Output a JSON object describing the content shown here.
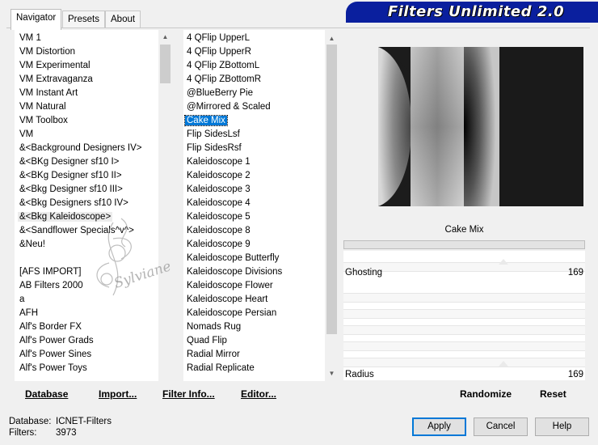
{
  "tabs": [
    "Navigator",
    "Presets",
    "About"
  ],
  "banner": "Filters Unlimited 2.0",
  "categories": [
    {
      "label": "VM 1"
    },
    {
      "label": "VM Distortion"
    },
    {
      "label": "VM Experimental"
    },
    {
      "label": "VM Extravaganza"
    },
    {
      "label": "VM Instant Art"
    },
    {
      "label": "VM Natural"
    },
    {
      "label": "VM Toolbox"
    },
    {
      "label": "VM"
    },
    {
      "label": "&<Background Designers IV>"
    },
    {
      "label": "&<BKg Designer sf10 I>"
    },
    {
      "label": "&<BKg Designer sf10 II>"
    },
    {
      "label": "&<Bkg Designer sf10 III>"
    },
    {
      "label": "&<Bkg Designers sf10 IV>"
    },
    {
      "label": "&<Bkg Kaleidoscope>"
    },
    {
      "label": "&<Sandflower Specials^v^>"
    },
    {
      "label": "&Neu!"
    },
    {
      "label": ""
    },
    {
      "label": "[AFS IMPORT]"
    },
    {
      "label": "AB Filters 2000"
    },
    {
      "label": "a"
    },
    {
      "label": "AFH"
    },
    {
      "label": "Alf's Border FX"
    },
    {
      "label": "Alf's Power Grads"
    },
    {
      "label": "Alf's Power Sines"
    },
    {
      "label": "Alf's Power Toys"
    }
  ],
  "selected_category": "&<Bkg Kaleidoscope>",
  "filters": [
    {
      "label": "4 QFlip UpperL"
    },
    {
      "label": "4 QFlip UpperR"
    },
    {
      "label": "4 QFlip ZBottomL"
    },
    {
      "label": "4 QFlip ZBottomR"
    },
    {
      "label": "@BlueBerry Pie"
    },
    {
      "label": "@Mirrored & Scaled"
    },
    {
      "label": "Cake Mix"
    },
    {
      "label": "Flip SidesLsf"
    },
    {
      "label": "Flip SidesRsf"
    },
    {
      "label": "Kaleidoscope 1"
    },
    {
      "label": "Kaleidoscope 2"
    },
    {
      "label": "Kaleidoscope 3"
    },
    {
      "label": "Kaleidoscope 4"
    },
    {
      "label": "Kaleidoscope 5"
    },
    {
      "label": "Kaleidoscope 8"
    },
    {
      "label": "Kaleidoscope 9"
    },
    {
      "label": "Kaleidoscope Butterfly"
    },
    {
      "label": "Kaleidoscope Divisions"
    },
    {
      "label": "Kaleidoscope Flower"
    },
    {
      "label": "Kaleidoscope Heart"
    },
    {
      "label": "Kaleidoscope Persian"
    },
    {
      "label": "Nomads Rug"
    },
    {
      "label": "Quad Flip"
    },
    {
      "label": "Radial Mirror"
    },
    {
      "label": "Radial Replicate"
    }
  ],
  "selected_filter": "Cake Mix",
  "watermark": "Sylviane",
  "toolbar": {
    "database": "Database",
    "import": "Import...",
    "filter_info": "Filter Info...",
    "editor": "Editor..."
  },
  "filter_title": "Cake Mix",
  "params": [
    {
      "label": "Ghosting",
      "value": "169"
    },
    {
      "label": "Radius",
      "value": "169"
    }
  ],
  "actions": {
    "randomize": "Randomize",
    "reset": "Reset"
  },
  "status": {
    "database_label": "Database:",
    "database_value": "ICNET-Filters",
    "filters_label": "Filters:",
    "filters_value": "3973"
  },
  "buttons": {
    "apply": "Apply",
    "cancel": "Cancel",
    "help": "Help"
  },
  "colors": {
    "selection": "#0078d7",
    "banner": "#0a1f9e"
  }
}
